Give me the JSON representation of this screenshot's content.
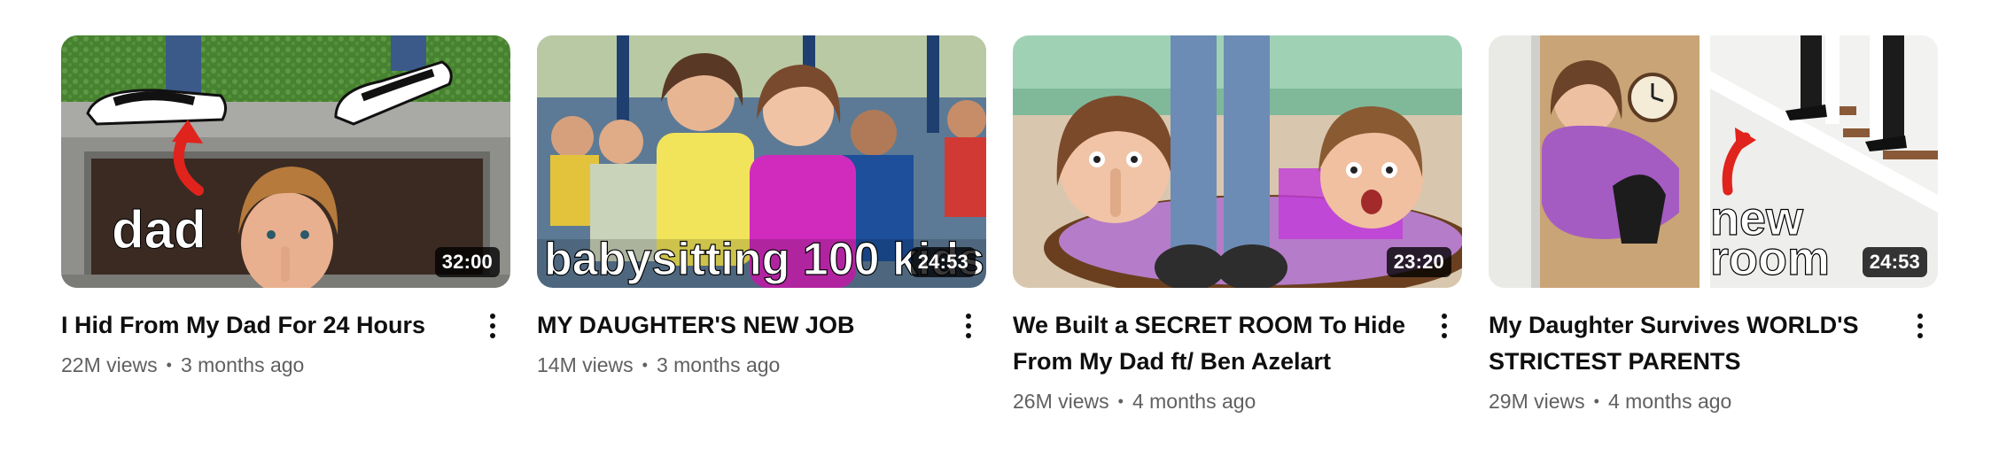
{
  "videos": [
    {
      "title": "I Hid From My Dad For 24 Hours",
      "views": "22M views",
      "age": "3 months ago",
      "duration": "32:00",
      "thumb_text": "dad"
    },
    {
      "title": "MY DAUGHTER'S NEW JOB",
      "views": "14M views",
      "age": "3 months ago",
      "duration": "24:53",
      "thumb_text": "babysitting 100 kids"
    },
    {
      "title": "We Built a SECRET ROOM To Hide From My Dad ft/ Ben Azelart",
      "views": "26M views",
      "age": "4 months ago",
      "duration": "23:20",
      "thumb_text": ""
    },
    {
      "title": "My Daughter Survives WORLD'S STRICTEST PARENTS",
      "views": "29M views",
      "age": "4 months ago",
      "duration": "24:53",
      "thumb_text": "new room"
    }
  ],
  "separator": "•",
  "menu_icon": "more-vert-icon",
  "colors": {
    "text": "#0f0f0f",
    "secondary": "#606060",
    "duration_bg": "#000000"
  }
}
